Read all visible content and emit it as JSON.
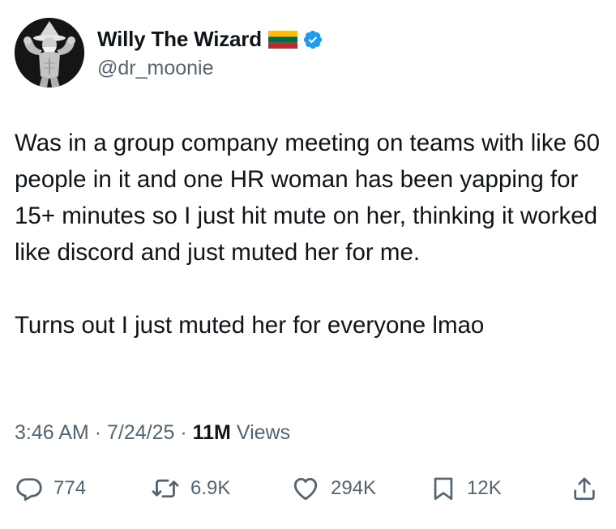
{
  "user": {
    "display_name": "Willy The Wizard",
    "handle": "@dr_moonie",
    "avatar_icon": "bodybuilder-wizard-avatar",
    "flag_icon": "lithuania-flag-icon",
    "verified_icon": "verified-badge-icon",
    "verified_color": "#1d9bf0"
  },
  "tweet": {
    "paragraphs": [
      "Was in a group company meeting on teams with like 60 people in it and one HR woman has been yapping for 15+ minutes so I just hit mute on her, thinking it worked like discord and just muted her for me.",
      "Turns out I just muted her for everyone lmao"
    ]
  },
  "meta": {
    "time": "3:46 AM",
    "sep1": "·",
    "date": "7/24/25",
    "sep2": "·",
    "views_count": "11M",
    "views_label": "Views"
  },
  "actions": {
    "replies": {
      "icon": "reply-bubble-icon",
      "count": "774"
    },
    "reposts": {
      "icon": "repost-icon",
      "count": "6.9K"
    },
    "likes": {
      "icon": "heart-icon",
      "count": "294K"
    },
    "bookmarks": {
      "icon": "bookmark-icon",
      "count": "12K"
    },
    "share": {
      "icon": "share-upload-icon"
    }
  },
  "colors": {
    "text_primary": "#0f1419",
    "text_secondary": "#536471",
    "flag_yellow": "#FDB913",
    "flag_green": "#006A44",
    "flag_red": "#C1272D"
  }
}
